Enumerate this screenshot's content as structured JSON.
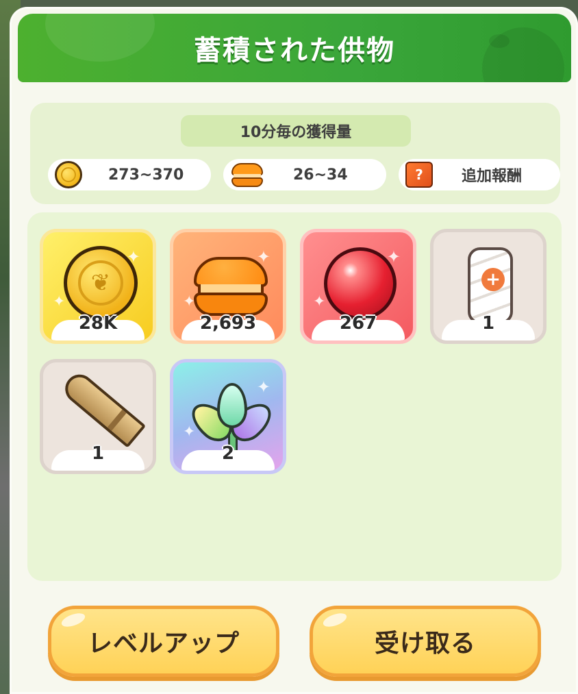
{
  "header": {
    "title": "蓄積された供物"
  },
  "rate": {
    "title": "10分毎の獲得量",
    "coin_range": "273~370",
    "macaron_range": "26~34",
    "bonus_label": "追加報酬",
    "bonus_icon_glyph": "?"
  },
  "items": [
    {
      "name": "coin",
      "count": "28K"
    },
    {
      "name": "macaron",
      "count": "2,693"
    },
    {
      "name": "jelly-gem",
      "count": "267"
    },
    {
      "name": "bandage",
      "count": "1"
    },
    {
      "name": "bullet",
      "count": "1"
    },
    {
      "name": "rainbow-leaf",
      "count": "2"
    }
  ],
  "buttons": {
    "level_up": "レベルアップ",
    "receive": "受け取る"
  },
  "colors": {
    "header_green": "#3aa63a",
    "button_yellow": "#ffd257",
    "button_border": "#f2a43a"
  }
}
